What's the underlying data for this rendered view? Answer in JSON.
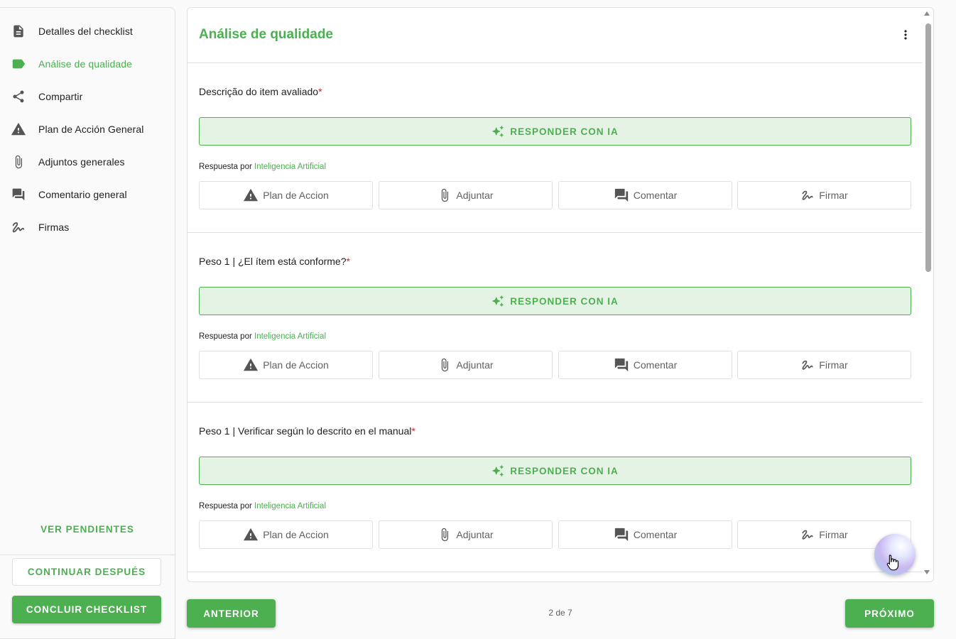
{
  "sidebar": {
    "items": [
      {
        "label": "Detalles del checklist",
        "icon": "document-icon",
        "active": false
      },
      {
        "label": "Análise de qualidade",
        "icon": "label-tag-icon",
        "active": true
      },
      {
        "label": "Compartir",
        "icon": "share-icon",
        "active": false
      },
      {
        "label": "Plan de Acción General",
        "icon": "warning-icon",
        "active": false
      },
      {
        "label": "Adjuntos generales",
        "icon": "paperclip-icon",
        "active": false
      },
      {
        "label": "Comentario general",
        "icon": "comment-icon",
        "active": false
      },
      {
        "label": "Firmas",
        "icon": "signature-icon",
        "active": false
      }
    ],
    "ver_pendientes": "VER PENDIENTES",
    "continuar_label": "CONTINUAR DESPUÉS",
    "concluir_label": "CONCLUIR CHECKLIST"
  },
  "main": {
    "title": "Análise de qualidade",
    "questions": [
      {
        "label": "Descrição do item avaliado",
        "required_mark": "*"
      },
      {
        "label": "Peso 1 | ¿El ítem está conforme?",
        "required_mark": "*"
      },
      {
        "label": "Peso 1 | Verificar según lo descrito en el manual",
        "required_mark": "*"
      }
    ],
    "ia_button_label": "RESPONDER CON IA",
    "response_prefix": "Respuesta por",
    "response_ai": "Inteligencia Artificial",
    "actions": {
      "plan": "Plan de Accion",
      "attach": "Adjuntar",
      "comment": "Comentar",
      "sign": "Firmar"
    }
  },
  "footer": {
    "prev_label": "ANTERIOR",
    "page_indicator": "2 de 7",
    "next_label": "PRÓXIMO"
  },
  "colors": {
    "accent": "#4caf50",
    "accent_light": "#e5f3e5",
    "required": "#c62828"
  }
}
